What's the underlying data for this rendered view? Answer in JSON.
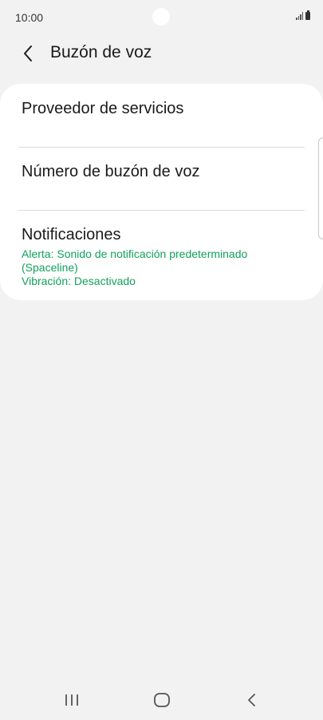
{
  "status_bar": {
    "time": "10:00",
    "icons": [
      "signal-icon",
      "battery-icon"
    ]
  },
  "header": {
    "back_icon": "chevron-left-icon",
    "title": "Buzón de voz"
  },
  "settings": {
    "items": [
      {
        "title": "Proveedor de servicios"
      },
      {
        "title": "Número de buzón de voz"
      },
      {
        "title": "Notificaciones",
        "subtitle_line1": "Alerta: Sonido de notificación predeterminado (Spaceline)",
        "subtitle_line2": "Vibración: Desactivado"
      }
    ]
  },
  "colors": {
    "background": "#f2f2f2",
    "card": "#ffffff",
    "accent_green": "#12a05c",
    "text": "#1a1a1a"
  },
  "nav_bar": {
    "icons": [
      "recent-apps-icon",
      "home-icon",
      "back-icon"
    ]
  }
}
